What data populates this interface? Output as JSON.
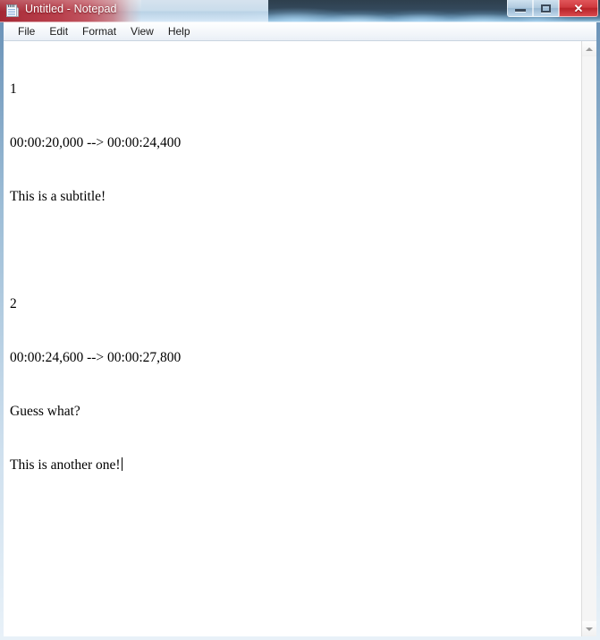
{
  "window": {
    "title": "Untitled - Notepad",
    "icon": "notepad-icon"
  },
  "controls": {
    "minimize_label": "–",
    "maximize_label": "□",
    "close_label": "✕"
  },
  "menubar": {
    "items": [
      {
        "label": "File"
      },
      {
        "label": "Edit"
      },
      {
        "label": "Format"
      },
      {
        "label": "View"
      },
      {
        "label": "Help"
      }
    ]
  },
  "document": {
    "lines": [
      "1",
      "00:00:20,000 --> 00:00:24,400",
      "This is a subtitle!",
      "",
      "2",
      "00:00:24,600 --> 00:00:27,800",
      "Guess what?",
      "This is another one!"
    ]
  },
  "scrollbar": {
    "up_arrow": "scroll-up-arrow",
    "down_arrow": "scroll-down-arrow"
  },
  "colors": {
    "titlebar_accent": "#b03541",
    "close_button": "#cf3a3f",
    "glass": "#d6e9f8",
    "text": "#000000",
    "client_bg": "#ffffff"
  }
}
